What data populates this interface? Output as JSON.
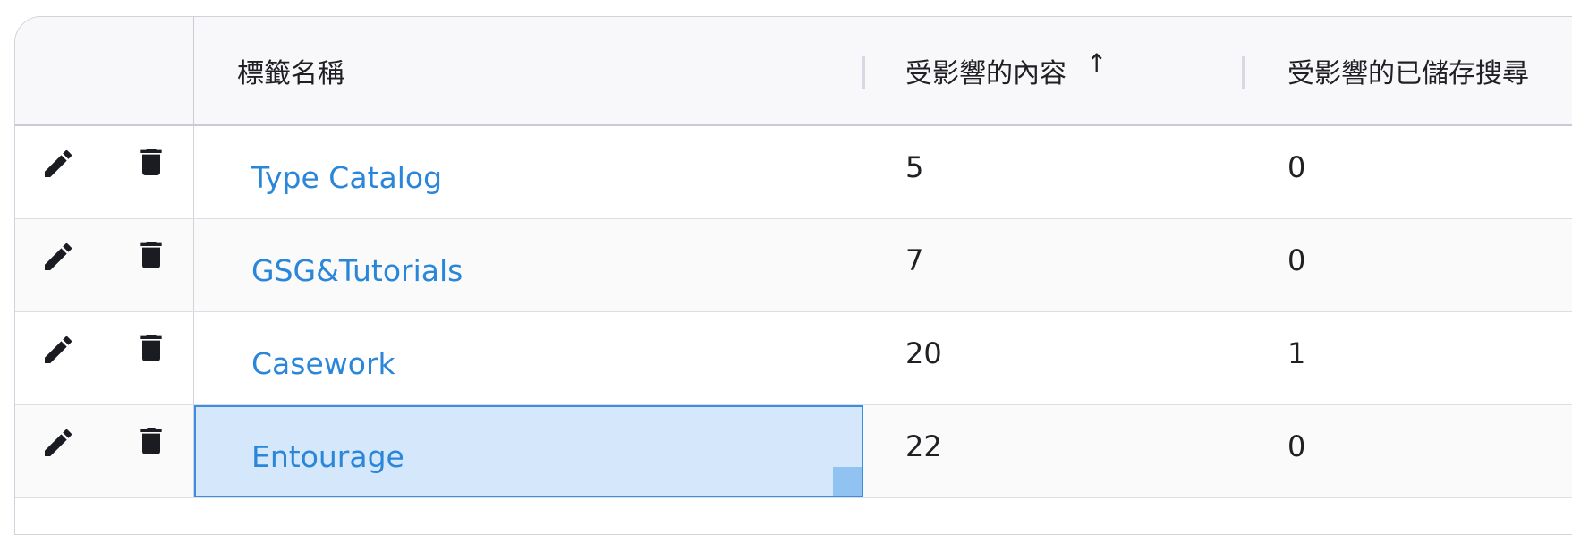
{
  "headers": {
    "name": "標籤名稱",
    "content": "受影響的內容",
    "saved": "受影響的已儲存搜尋",
    "sort_icon": "↑"
  },
  "icons": {
    "edit": "pencil-icon",
    "delete": "trash-icon"
  },
  "colors": {
    "link": "#2a86d9",
    "selection_fill": "#d5e8fb",
    "selection_border": "#3b8de0",
    "header_bg": "#f8f8fa"
  },
  "rows": [
    {
      "name": "Type Catalog",
      "content": "5",
      "saved": "0"
    },
    {
      "name": "GSG&Tutorials",
      "content": "7",
      "saved": "0"
    },
    {
      "name": "Casework",
      "content": "20",
      "saved": "1"
    },
    {
      "name": "Entourage",
      "content": "22",
      "saved": "0",
      "selected": true
    }
  ]
}
